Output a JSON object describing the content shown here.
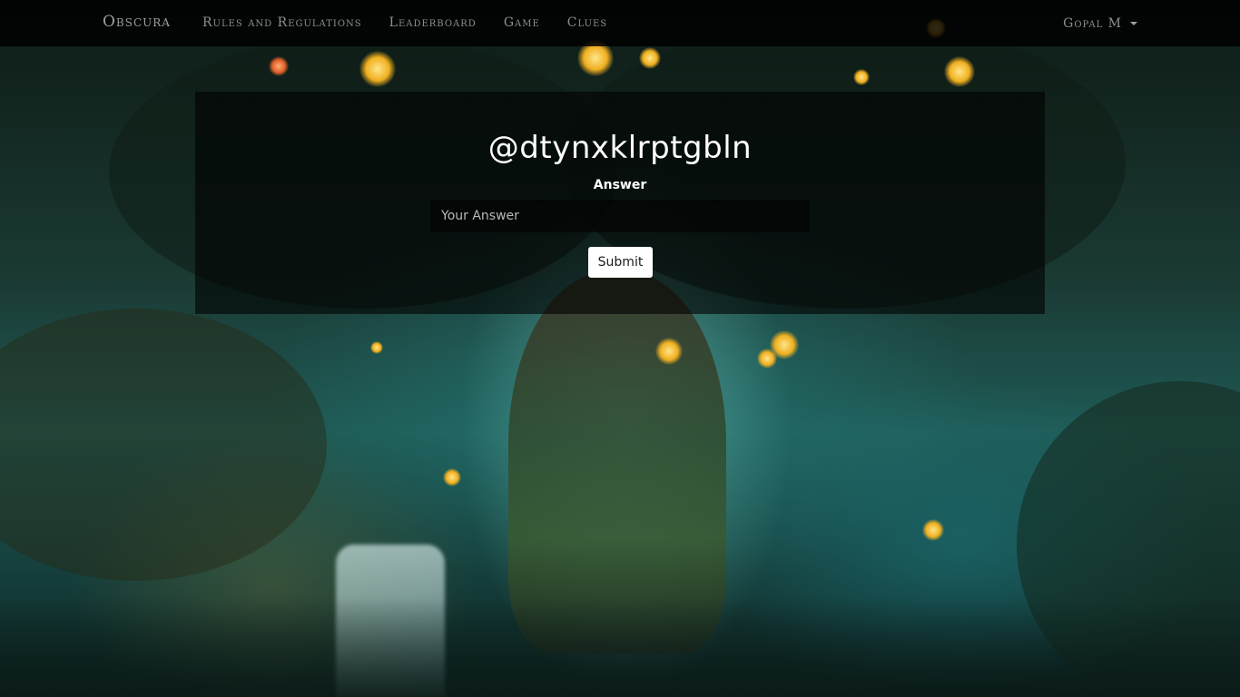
{
  "nav": {
    "brand": "Obscura",
    "links": [
      {
        "label": "Rules and Regulations"
      },
      {
        "label": "Leaderboard"
      },
      {
        "label": "Game"
      },
      {
        "label": "Clues"
      }
    ],
    "user": {
      "name": "Gopal M",
      "icon": "caret-down-icon"
    }
  },
  "question": {
    "title": "@dtynxklrptgbln",
    "answer_label": "Answer",
    "answer_placeholder": "Your Answer",
    "answer_value": "",
    "submit_label": "Submit"
  },
  "colors": {
    "navbar_bg": "#000000",
    "nav_text": "#8e8e8e",
    "card_bg": "#000000",
    "title_text": "#ffffff",
    "button_bg": "#ffffff",
    "button_text": "#1a1a1a"
  }
}
